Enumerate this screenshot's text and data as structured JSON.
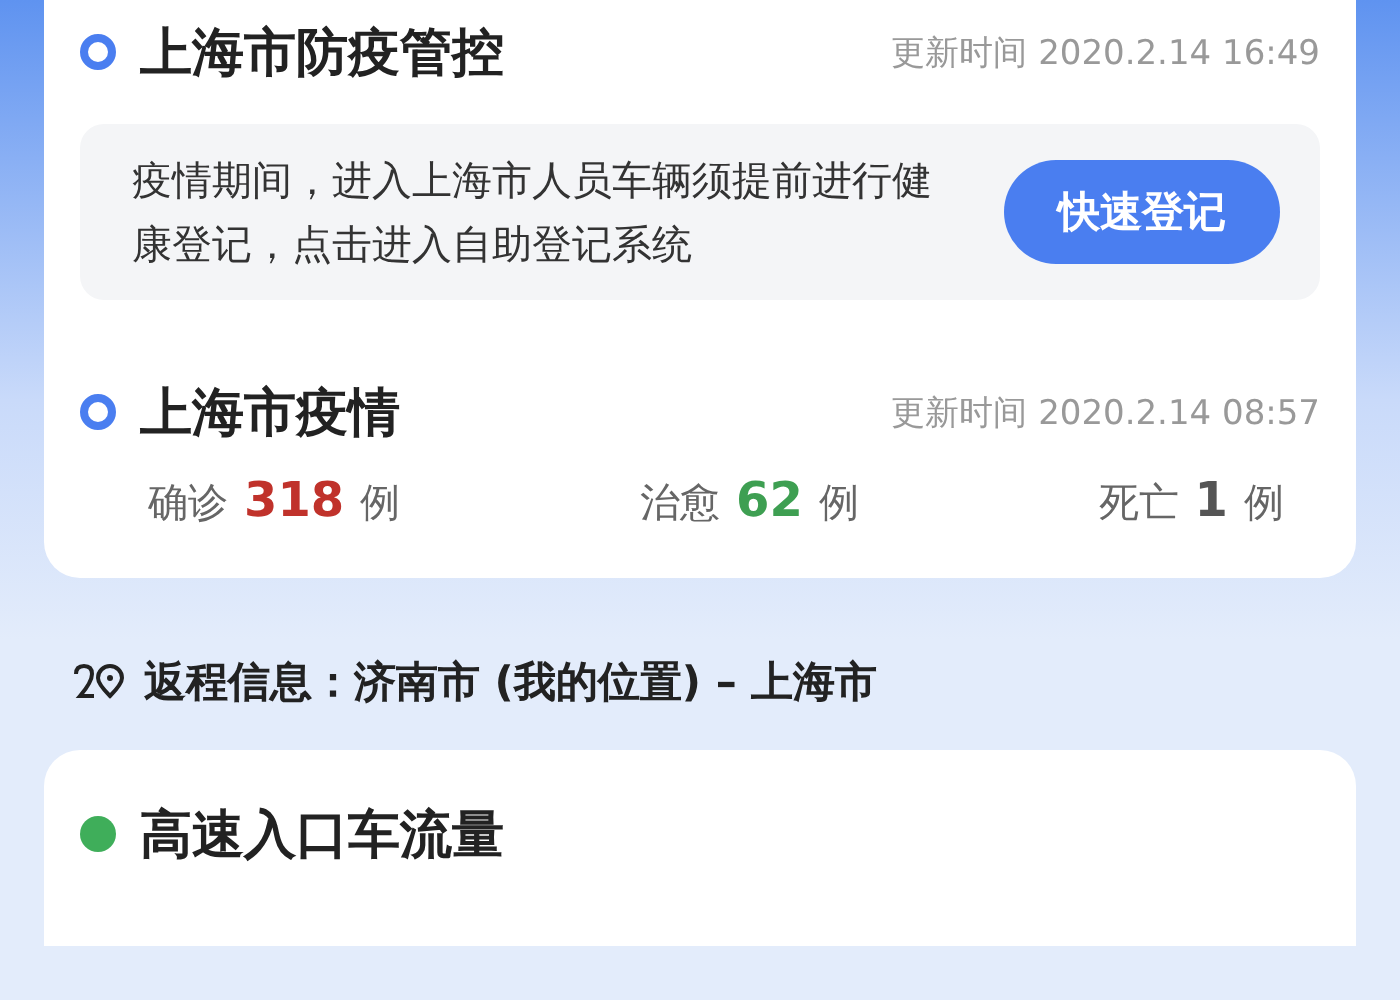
{
  "sections": [
    {
      "title": "上海市防疫管控",
      "color": "#4a7ef0",
      "updated": "更新时间 2020.2.14 16:49",
      "notice": {
        "text": "疫情期间，进入上海市人员车辆须提前进行健康登记，点击进入自助登记系统",
        "button": "快速登记"
      }
    },
    {
      "title": "上海市疫情",
      "color": "#4a7ef0",
      "updated": "更新时间 2020.2.14 08:57",
      "stats": [
        {
          "label": "确诊",
          "value": "318",
          "unit": "例",
          "color": "#c0322b"
        },
        {
          "label": "治愈",
          "value": "62",
          "unit": "例",
          "color": "#3e9f52"
        },
        {
          "label": "死亡",
          "value": "1",
          "unit": "例",
          "color": "#555555"
        }
      ]
    }
  ],
  "route": {
    "text": "返程信息：济南市 (我的位置) – 上海市"
  },
  "next_card": {
    "title": "高速入口车流量",
    "color": "#3fae5a"
  }
}
